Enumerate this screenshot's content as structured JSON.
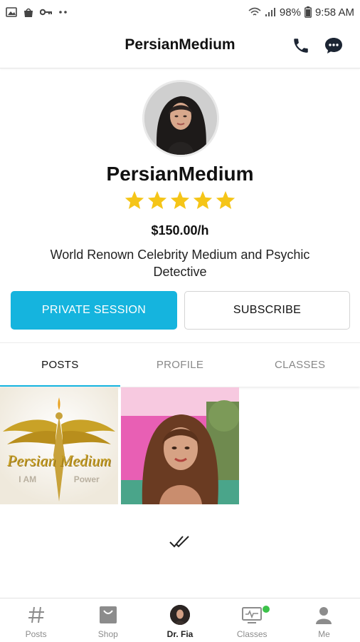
{
  "status_bar": {
    "battery": "98%",
    "time": "9:58 AM",
    "left_icons": [
      "image-icon",
      "bag-icon",
      "key-icon",
      "dots-icon"
    ],
    "right_icons": [
      "wifi-icon",
      "signal-icon",
      "battery-icon"
    ]
  },
  "header": {
    "title": "PersianMedium",
    "actions": [
      "phone-icon",
      "chat-icon"
    ]
  },
  "profile": {
    "name": "PersianMedium",
    "rating": 5,
    "price": "$150.00/h",
    "bio": "World Renown Celebrity Medium and Psychic Detective"
  },
  "actions": {
    "private_session": "PRIVATE SESSION",
    "subscribe": "SUBSCRIBE"
  },
  "tabs": [
    {
      "label": "POSTS",
      "active": true
    },
    {
      "label": "PROFILE",
      "active": false
    },
    {
      "label": "CLASSES",
      "active": false
    }
  ],
  "posts": [
    {
      "logo_text": "Persian Medium",
      "subtitle_left": "I AM",
      "subtitle_right": "Power"
    },
    {
      "kind": "portrait-photo"
    }
  ],
  "bottom_nav": [
    {
      "label": "Posts",
      "icon": "hashtag-icon",
      "active": false
    },
    {
      "label": "Shop",
      "icon": "shop-icon",
      "active": false
    },
    {
      "label": "Dr. Fia",
      "icon": "avatar",
      "active": true
    },
    {
      "label": "Classes",
      "icon": "classes-icon",
      "active": false,
      "badge": true
    },
    {
      "label": "Me",
      "icon": "person-icon",
      "active": false
    }
  ],
  "colors": {
    "accent": "#15b4de",
    "star": "#f5c518",
    "badge": "#3cc24a"
  }
}
